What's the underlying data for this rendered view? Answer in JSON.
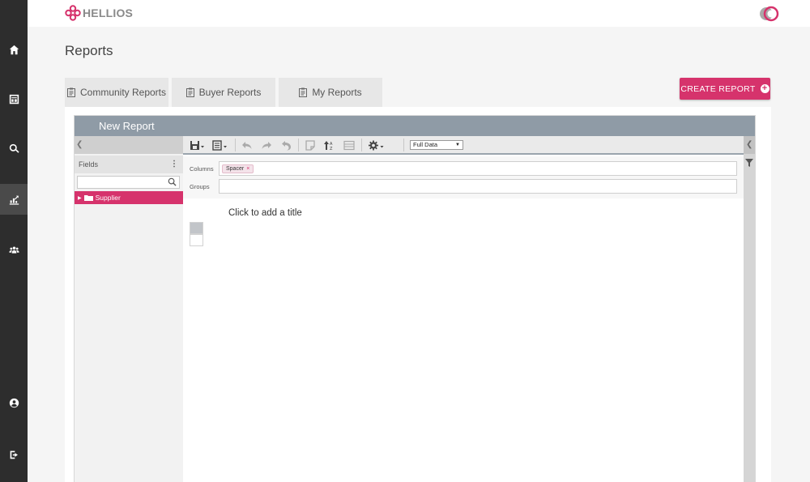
{
  "app": {
    "logo_text": "HELLIOS"
  },
  "nav": {
    "items": [
      {
        "name": "home",
        "icon": "home-icon"
      },
      {
        "name": "dashboard",
        "icon": "dashboard-icon"
      },
      {
        "name": "search",
        "icon": "search-icon"
      },
      {
        "name": "reports",
        "icon": "chart-icon",
        "active": true
      },
      {
        "name": "users",
        "icon": "users-icon"
      },
      {
        "name": "profile",
        "icon": "user-circle-icon"
      },
      {
        "name": "logout",
        "icon": "logout-icon"
      }
    ]
  },
  "page": {
    "title": "Reports"
  },
  "tabs": [
    {
      "label": "Community Reports"
    },
    {
      "label": "Buyer Reports"
    },
    {
      "label": "My Reports"
    }
  ],
  "actions": {
    "create_label": "CREATE REPORT"
  },
  "designer": {
    "header_title": "New Report",
    "fields": {
      "heading": "Fields",
      "search_placeholder": "",
      "items": [
        {
          "label": "Supplier"
        }
      ]
    },
    "toolbar": {
      "data_mode": "Full Data"
    },
    "config": {
      "columns_label": "Columns",
      "groups_label": "Groups",
      "columns": [
        "Spacer"
      ]
    },
    "canvas": {
      "title_prompt": "Click to add a title"
    }
  },
  "colors": {
    "accent": "#d6336c",
    "rail": "#2d2d2d",
    "header": "#8f9ba6"
  }
}
